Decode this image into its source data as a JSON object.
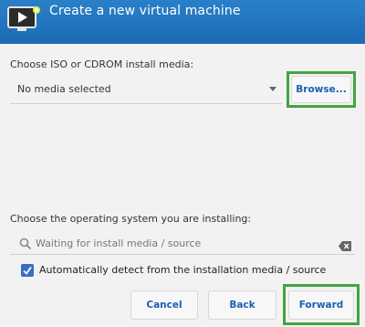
{
  "window": {
    "title": "Create a new virtual machine",
    "icon": "vm-monitor-icon"
  },
  "media": {
    "label": "Choose ISO or CDROM install media:",
    "selected": "No media selected",
    "browse_label": "Browse..."
  },
  "os": {
    "label": "Choose the operating system you are installing:",
    "search_placeholder": "Waiting for install media / source",
    "auto_detect_label": "Automatically detect from the installation media / source",
    "auto_detect_checked": true
  },
  "footer": {
    "cancel_label": "Cancel",
    "back_label": "Back",
    "forward_label": "Forward"
  },
  "colors": {
    "header": "#1f74bd",
    "accent_text": "#1a5fb4",
    "highlight": "#3fa63f",
    "checkbox": "#3a6ebf"
  }
}
